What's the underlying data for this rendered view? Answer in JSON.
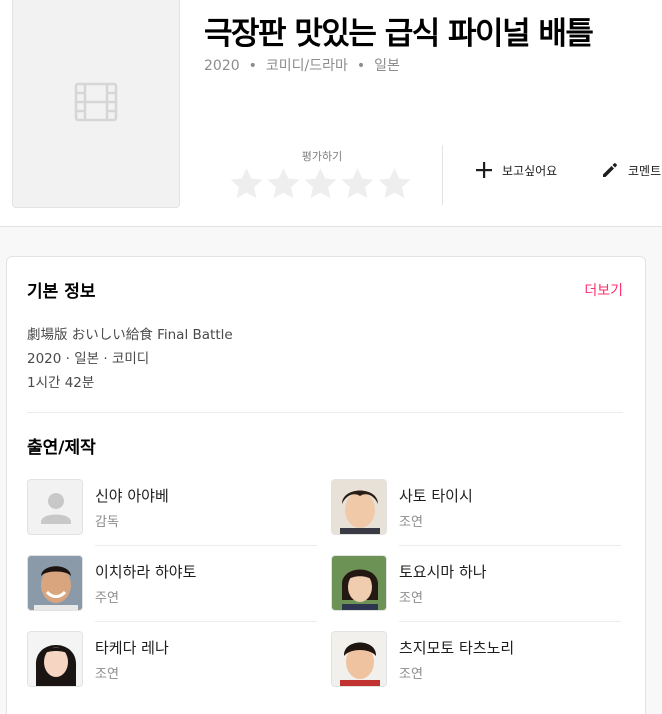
{
  "movie": {
    "title": "극장판 맛있는 급식 파이널 배틀",
    "year": "2020",
    "genre": "코미디/드라마",
    "country": "일본",
    "dot": "•"
  },
  "rating": {
    "label": "평가하기",
    "stars": 5
  },
  "actions": {
    "want": "보고싶어요",
    "comment": "코멘트"
  },
  "basic_info": {
    "title": "기본 정보",
    "more": "더보기",
    "original_title": "劇場版 おいしい給食 Final Battle",
    "summary": "2020 · 일본 · 코미디",
    "runtime": "1시간 42분"
  },
  "cast_section": {
    "title": "출연/제작"
  },
  "cast": [
    {
      "name": "신야 아야베",
      "role": "감독",
      "avatar": "placeholder"
    },
    {
      "name": "사토 타이시",
      "role": "조연",
      "avatar": "boy-photo"
    },
    {
      "name": "이치하라 하야토",
      "role": "주연",
      "avatar": "man-photo"
    },
    {
      "name": "토요시마 하나",
      "role": "조연",
      "avatar": "girl-photo"
    },
    {
      "name": "타케다 레나",
      "role": "조연",
      "avatar": "woman-photo"
    },
    {
      "name": "츠지모토 타츠노리",
      "role": "조연",
      "avatar": "boy2-photo"
    }
  ],
  "colors": {
    "accent": "#ff2f6e",
    "star_empty": "#eeeeee"
  }
}
